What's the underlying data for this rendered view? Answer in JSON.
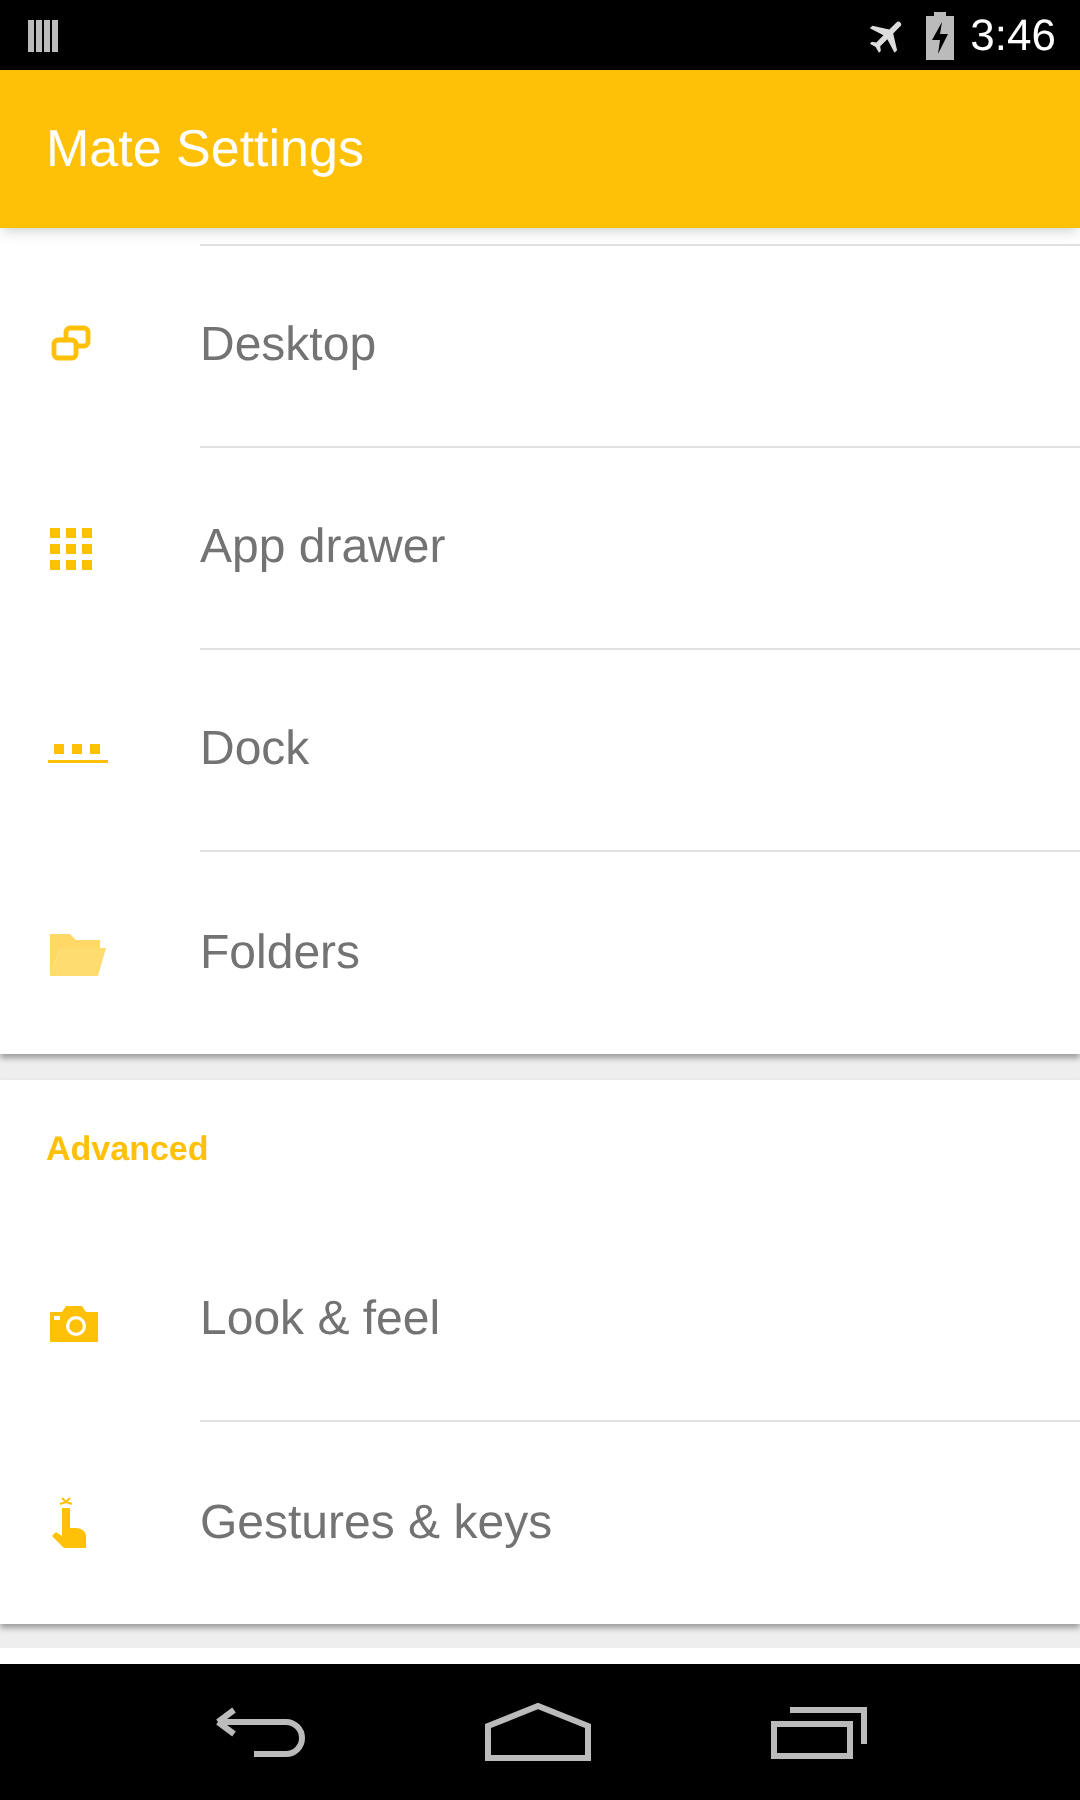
{
  "status_bar": {
    "time": "3:46"
  },
  "app_bar": {
    "title": "Mate Settings"
  },
  "sections": [
    {
      "items": [
        {
          "label": "Desktop"
        },
        {
          "label": "App drawer"
        },
        {
          "label": "Dock"
        },
        {
          "label": "Folders"
        }
      ]
    },
    {
      "header": "Advanced",
      "items": [
        {
          "label": "Look & feel"
        },
        {
          "label": "Gestures & keys"
        }
      ]
    }
  ]
}
